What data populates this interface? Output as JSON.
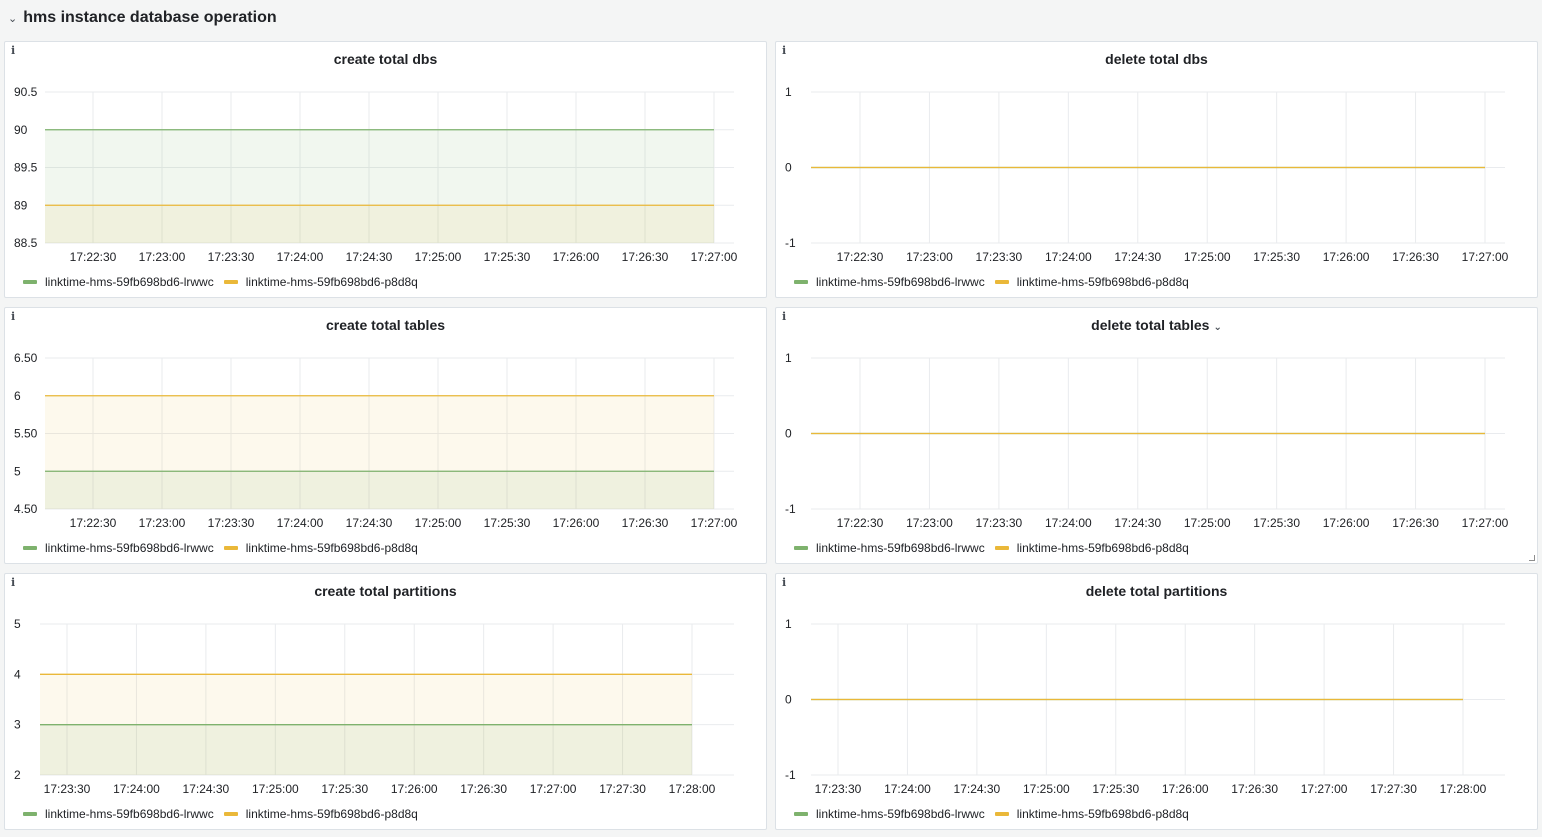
{
  "row": {
    "title": "hms instance database operation",
    "chevron": "⌄"
  },
  "series_colors": [
    "#7eb26d",
    "#eab839"
  ],
  "series_fill": [
    "rgba(126,178,109,0.11)",
    "rgba(234,184,57,0.09)"
  ],
  "panels": [
    {
      "title": "create total dbs",
      "info": "i",
      "has_dropdown": false,
      "legend": [
        "linktime-hms-59fb698bd6-lrwwc",
        "linktime-hms-59fb698bd6-p8d8q"
      ]
    },
    {
      "title": "delete total dbs",
      "info": "i",
      "has_dropdown": false,
      "legend": [
        "linktime-hms-59fb698bd6-lrwwc",
        "linktime-hms-59fb698bd6-p8d8q"
      ]
    },
    {
      "title": "create total tables",
      "info": "i",
      "has_dropdown": false,
      "legend": [
        "linktime-hms-59fb698bd6-lrwwc",
        "linktime-hms-59fb698bd6-p8d8q"
      ]
    },
    {
      "title": "delete total tables",
      "info": "i",
      "has_dropdown": true,
      "dropdown_icon": "⌄",
      "legend": [
        "linktime-hms-59fb698bd6-lrwwc",
        "linktime-hms-59fb698bd6-p8d8q"
      ]
    },
    {
      "title": "create total partitions",
      "info": "i",
      "has_dropdown": false,
      "legend": [
        "linktime-hms-59fb698bd6-lrwwc",
        "linktime-hms-59fb698bd6-p8d8q"
      ]
    },
    {
      "title": "delete total partitions",
      "info": "i",
      "has_dropdown": false,
      "legend": [
        "linktime-hms-59fb698bd6-lrwwc",
        "linktime-hms-59fb698bd6-p8d8q"
      ]
    }
  ],
  "chart_data": [
    {
      "type": "area",
      "title": "create total dbs",
      "x": [
        "17:22:30",
        "17:23:00",
        "17:23:30",
        "17:24:00",
        "17:24:30",
        "17:25:00",
        "17:25:30",
        "17:26:00",
        "17:26:30",
        "17:27:00"
      ],
      "ylim": [
        88.5,
        90.5
      ],
      "yticks": [
        "88.5",
        "89",
        "89.5",
        "90",
        "90.5"
      ],
      "series": [
        {
          "name": "linktime-hms-59fb698bd6-lrwwc",
          "values": [
            90,
            90,
            90,
            90,
            90,
            90,
            90,
            90,
            90,
            90
          ]
        },
        {
          "name": "linktime-hms-59fb698bd6-p8d8q",
          "values": [
            89,
            89,
            89,
            89,
            89,
            89,
            89,
            89,
            89,
            89
          ]
        }
      ],
      "grid": true,
      "legend": "bottom-left"
    },
    {
      "type": "line",
      "title": "delete total dbs",
      "x": [
        "17:22:30",
        "17:23:00",
        "17:23:30",
        "17:24:00",
        "17:24:30",
        "17:25:00",
        "17:25:30",
        "17:26:00",
        "17:26:30",
        "17:27:00"
      ],
      "ylim": [
        -1,
        1
      ],
      "yticks": [
        "-1",
        "0",
        "1"
      ],
      "series": [
        {
          "name": "linktime-hms-59fb698bd6-lrwwc",
          "values": [
            0,
            0,
            0,
            0,
            0,
            0,
            0,
            0,
            0,
            0
          ]
        },
        {
          "name": "linktime-hms-59fb698bd6-p8d8q",
          "values": [
            0,
            0,
            0,
            0,
            0,
            0,
            0,
            0,
            0,
            0
          ]
        }
      ],
      "grid": true,
      "legend": "bottom-left"
    },
    {
      "type": "area",
      "title": "create total tables",
      "x": [
        "17:22:30",
        "17:23:00",
        "17:23:30",
        "17:24:00",
        "17:24:30",
        "17:25:00",
        "17:25:30",
        "17:26:00",
        "17:26:30",
        "17:27:00"
      ],
      "ylim": [
        4.5,
        6.5
      ],
      "yticks": [
        "4.50",
        "5",
        "5.50",
        "6",
        "6.50"
      ],
      "series": [
        {
          "name": "linktime-hms-59fb698bd6-lrwwc",
          "values": [
            5,
            5,
            5,
            5,
            5,
            5,
            5,
            5,
            5,
            5
          ]
        },
        {
          "name": "linktime-hms-59fb698bd6-p8d8q",
          "values": [
            6,
            6,
            6,
            6,
            6,
            6,
            6,
            6,
            6,
            6
          ]
        }
      ],
      "grid": true,
      "legend": "bottom-left"
    },
    {
      "type": "line",
      "title": "delete total tables",
      "x": [
        "17:22:30",
        "17:23:00",
        "17:23:30",
        "17:24:00",
        "17:24:30",
        "17:25:00",
        "17:25:30",
        "17:26:00",
        "17:26:30",
        "17:27:00"
      ],
      "ylim": [
        -1,
        1
      ],
      "yticks": [
        "-1",
        "0",
        "1"
      ],
      "series": [
        {
          "name": "linktime-hms-59fb698bd6-lrwwc",
          "values": [
            0,
            0,
            0,
            0,
            0,
            0,
            0,
            0,
            0,
            0
          ]
        },
        {
          "name": "linktime-hms-59fb698bd6-p8d8q",
          "values": [
            0,
            0,
            0,
            0,
            0,
            0,
            0,
            0,
            0,
            0
          ]
        }
      ],
      "grid": true,
      "legend": "bottom-left"
    },
    {
      "type": "area",
      "title": "create total partitions",
      "x": [
        "17:23:30",
        "17:24:00",
        "17:24:30",
        "17:25:00",
        "17:25:30",
        "17:26:00",
        "17:26:30",
        "17:27:00",
        "17:27:30",
        "17:28:00"
      ],
      "ylim": [
        2,
        5
      ],
      "yticks": [
        "2",
        "3",
        "4",
        "5"
      ],
      "series": [
        {
          "name": "linktime-hms-59fb698bd6-lrwwc",
          "values": [
            3,
            3,
            3,
            3,
            3,
            3,
            3,
            3,
            3,
            3
          ]
        },
        {
          "name": "linktime-hms-59fb698bd6-p8d8q",
          "values": [
            4,
            4,
            4,
            4,
            4,
            4,
            4,
            4,
            4,
            4
          ]
        }
      ],
      "grid": true,
      "legend": "bottom-left"
    },
    {
      "type": "line",
      "title": "delete total partitions",
      "x": [
        "17:23:30",
        "17:24:00",
        "17:24:30",
        "17:25:00",
        "17:25:30",
        "17:26:00",
        "17:26:30",
        "17:27:00",
        "17:27:30",
        "17:28:00"
      ],
      "ylim": [
        -1,
        1
      ],
      "yticks": [
        "-1",
        "0",
        "1"
      ],
      "series": [
        {
          "name": "linktime-hms-59fb698bd6-lrwwc",
          "values": [
            0,
            0,
            0,
            0,
            0,
            0,
            0,
            0,
            0,
            0
          ]
        },
        {
          "name": "linktime-hms-59fb698bd6-p8d8q",
          "values": [
            0,
            0,
            0,
            0,
            0,
            0,
            0,
            0,
            0,
            0
          ]
        }
      ],
      "grid": true,
      "legend": "bottom-left"
    }
  ]
}
